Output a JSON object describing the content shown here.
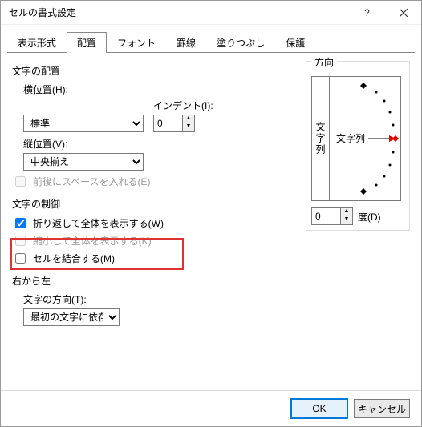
{
  "window": {
    "title": "セルの書式設定"
  },
  "tabs": [
    "表示形式",
    "配置",
    "フォント",
    "罫線",
    "塗りつぶし",
    "保護"
  ],
  "active_tab_index": 1,
  "alignment": {
    "section_label": "文字の配置",
    "horizontal_label": "横位置(H):",
    "horizontal_value": "標準",
    "indent_label": "インデント(I):",
    "indent_value": "0",
    "vertical_label": "縦位置(V):",
    "vertical_value": "中央揃え",
    "justify_distributed_label": "前後にスペースを入れる(E)"
  },
  "text_control": {
    "section_label": "文字の制御",
    "wrap_label": "折り返して全体を表示する(W)",
    "wrap_checked": true,
    "shrink_label": "縮小して全体を表示する(K)",
    "merge_label": "セルを結合する(M)"
  },
  "rtl": {
    "section_label": "右から左",
    "direction_label": "文字の方向(T):",
    "direction_value": "最初の文字に依存"
  },
  "orientation": {
    "section_label": "方向",
    "vertical_text": "文字列",
    "dial_text": "文字列",
    "degrees_value": "0",
    "degrees_label": "度(D)"
  },
  "buttons": {
    "ok": "OK",
    "cancel": "キャンセル"
  }
}
